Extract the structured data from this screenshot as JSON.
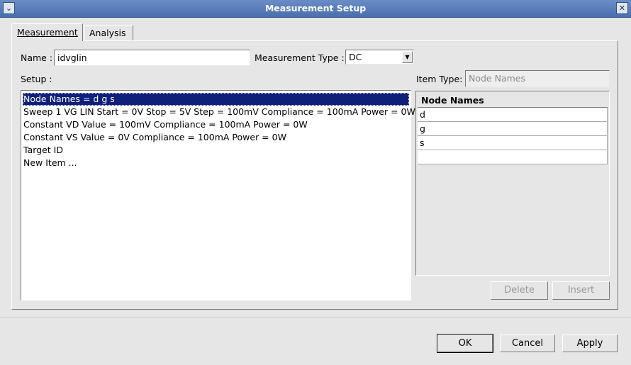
{
  "window": {
    "title": "Measurement Setup",
    "menu_glyph": "⌄",
    "close_glyph": "✕"
  },
  "tabs": [
    {
      "label": "Measurement",
      "active": true
    },
    {
      "label": "Analysis",
      "active": false
    }
  ],
  "form": {
    "name_label": "Name :",
    "name_value": "idvglin",
    "measurement_type_label": "Measurement Type :",
    "measurement_type_value": "DC",
    "setup_label": "Setup :",
    "item_type_label": "Item Type:",
    "item_type_value": "Node Names"
  },
  "setup_items": [
    "Node Names = d g s",
    "Sweep 1 VG LIN Start = 0V Stop = 5V Step = 100mV Compliance = 100mA Power = 0W",
    "Constant VD Value = 100mV Compliance = 100mA Power = 0W",
    "Constant VS Value = 0V Compliance = 100mA Power = 0W",
    "Target ID",
    "New Item ..."
  ],
  "node_table": {
    "header": "Node Names",
    "rows": [
      "d",
      "g",
      "s",
      ""
    ]
  },
  "buttons": {
    "delete": "Delete",
    "insert": "Insert",
    "ok": "OK",
    "cancel": "Cancel",
    "apply": "Apply"
  },
  "colors": {
    "titlebar": "#4a6fae",
    "selection": "#0f1f7a",
    "background": "#e6e6e6"
  }
}
